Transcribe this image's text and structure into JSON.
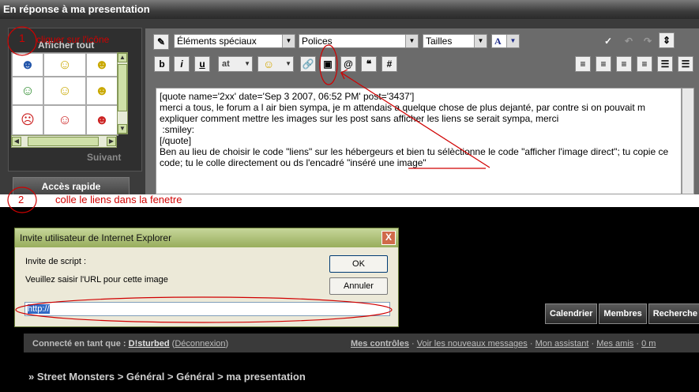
{
  "page": {
    "title": "En réponse à ma presentation"
  },
  "smileys": {
    "show_all": "Afficher tout",
    "next": "Suivant",
    "grid": [
      "☻",
      "☺",
      "☻",
      "☺",
      "☺",
      "☻",
      "☹",
      "☺",
      "☻"
    ]
  },
  "quick_access": "Accès rapide",
  "toolbar": {
    "special_elements": "Éléments spéciaux",
    "fonts": "Polices",
    "sizes": "Tailles",
    "color_btn": "A",
    "bold": "b",
    "italic": "i",
    "underline": "u",
    "shadow": "at",
    "smiley": "☺"
  },
  "editor": {
    "text": "[quote name='2xx' date='Sep 3 2007, 06:52 PM' post='3437']\nmerci a tous, le forum a l air bien sympa, je m attendais a quelque chose de plus dejanté, par contre si on pouvait m expliquer comment mettre les images sur les post sans afficher les liens se serait sympa, merci\n :smiley:\n[/quote]\nBen au lieu de choisir le code \"liens\" sur les hébergeurs et bien tu sélèctionne le code \"afficher l'image direct\"; tu copie ce code; tu le colle directement ou ds l'encadré \"inséré une image\""
  },
  "annotations": {
    "step1_number": "1",
    "step1_text": "cliquer sur l'icône",
    "step2_number": "2",
    "step2_text": "colle le liens dans la fenetre",
    "color": "#d00000"
  },
  "dialog": {
    "title": "Invite utilisateur de Internet Explorer",
    "close": "X",
    "line1": "Invite de script :",
    "line2": "Veuillez saisir l'URL pour cette image",
    "ok": "OK",
    "cancel": "Annuler",
    "input_value": "http://"
  },
  "nav": {
    "items": [
      "Calendrier",
      "Membres",
      "Recherche"
    ]
  },
  "status": {
    "connected_label": "Connecté en tant que :",
    "user": "D!sturbed",
    "logout": "Déconnexion",
    "links": [
      "Mes contrôles",
      "Voir les nouveaux messages",
      "Mon assistant",
      "Mes amis",
      "0 m"
    ]
  },
  "breadcrumb": "» Street Monsters > Général > Général > ma presentation"
}
